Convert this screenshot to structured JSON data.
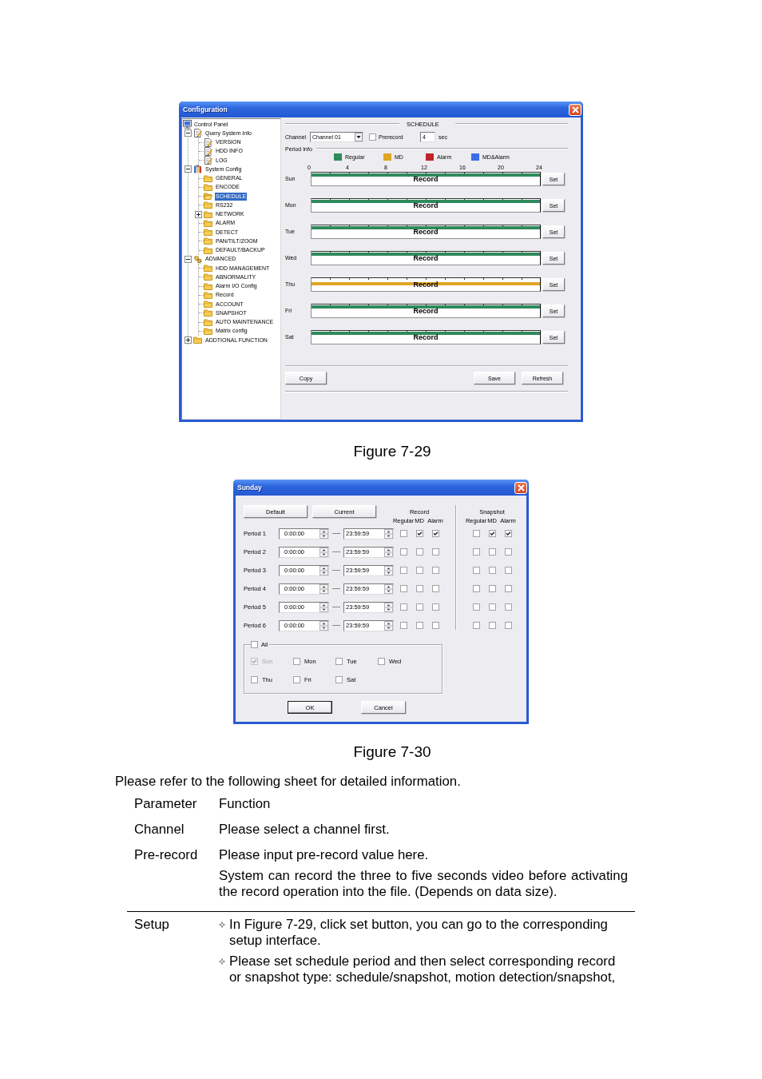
{
  "config_window": {
    "window": {
      "title": "Configuration"
    },
    "tree": [
      {
        "label": "Control Panel",
        "kind": "computer",
        "selected": false,
        "children": [
          {
            "label": "Query System Info",
            "kind": "document",
            "expanded": true,
            "selected": false,
            "children": [
              {
                "label": "VERSION",
                "kind": "document",
                "selected": false
              },
              {
                "label": "HDD INFO",
                "kind": "document",
                "selected": false
              },
              {
                "label": "LOG",
                "kind": "document",
                "selected": false
              }
            ]
          },
          {
            "label": "System Config",
            "kind": "tools",
            "expanded": true,
            "selected": false,
            "children": [
              {
                "label": "GENERAL",
                "kind": "folder",
                "selected": false
              },
              {
                "label": "ENCODE",
                "kind": "folder",
                "selected": false
              },
              {
                "label": "SCHEDULE",
                "kind": "folder",
                "selected": true
              },
              {
                "label": "RS232",
                "kind": "folder",
                "selected": false
              },
              {
                "label": "NETWORK",
                "kind": "folder",
                "expanded": false,
                "selected": false
              },
              {
                "label": "ALARM",
                "kind": "folder",
                "selected": false
              },
              {
                "label": "DETECT",
                "kind": "folder",
                "selected": false
              },
              {
                "label": "PAN/TILT/ZOOM",
                "kind": "folder",
                "selected": false
              },
              {
                "label": "DEFAULT/BACKUP",
                "kind": "folder",
                "selected": false
              }
            ]
          },
          {
            "label": "ADVANCED",
            "kind": "gears",
            "expanded": true,
            "selected": false,
            "children": [
              {
                "label": "HDD MANAGEMENT",
                "kind": "folder",
                "selected": false
              },
              {
                "label": "ABNORMALITY",
                "kind": "folder",
                "selected": false
              },
              {
                "label": "Alarm I/O Config",
                "kind": "folder",
                "selected": false
              },
              {
                "label": "Record",
                "kind": "folder",
                "selected": false
              },
              {
                "label": "ACCOUNT",
                "kind": "folder",
                "selected": false
              },
              {
                "label": "SNAPSHOT",
                "kind": "folder",
                "selected": false
              },
              {
                "label": "AUTO MAINTENANCE",
                "kind": "folder",
                "selected": false
              },
              {
                "label": "Matrix config",
                "kind": "folder",
                "selected": false
              }
            ]
          },
          {
            "label": "ADDTIONAL FUNCTION",
            "kind": "folder",
            "expanded": false,
            "selected": false
          }
        ]
      }
    ],
    "schedule": {
      "title": "SCHEDULE",
      "channel": {
        "label": "Channel",
        "value": "Channel 01"
      },
      "prerecord": {
        "label": "Prerecord",
        "checked": false,
        "value": "4",
        "unit": "sec"
      },
      "period_info": "Period Info",
      "legend": [
        {
          "label": "Regular",
          "color": "#2f8a5c"
        },
        {
          "label": "MD",
          "color": "#e0a524"
        },
        {
          "label": "Alarm",
          "color": "#c0232a"
        },
        {
          "label": "MD&Alarm",
          "color": "#3a6fe8"
        }
      ],
      "hours": [
        "0",
        "4",
        "8",
        "12",
        "16",
        "20",
        "24"
      ],
      "days": [
        {
          "label": "Sun",
          "color": "#2f8a5c",
          "bar_text": "Record",
          "button": "Set"
        },
        {
          "label": "Mon",
          "color": "#2f8a5c",
          "bar_text": "Record",
          "button": "Set"
        },
        {
          "label": "Tue",
          "color": "#2f8a5c",
          "bar_text": "Record",
          "button": "Set"
        },
        {
          "label": "Wed",
          "color": "#2f8a5c",
          "bar_text": "Record",
          "button": "Set"
        },
        {
          "label": "Thu",
          "color": "#e0a524",
          "bar_text": "Record",
          "button": "Set"
        },
        {
          "label": "Fri",
          "color": "#2f8a5c",
          "bar_text": "Record",
          "button": "Set"
        },
        {
          "label": "Sat",
          "color": "#2f8a5c",
          "bar_text": "Record",
          "button": "Set"
        }
      ],
      "buttons": [
        "Copy",
        "Save",
        "Refresh"
      ]
    },
    "caption": "Figure 7-29"
  },
  "period_dialog": {
    "window": {
      "title": "Sunday"
    },
    "presets": [
      "Default",
      "Current"
    ],
    "record": {
      "title": "Record",
      "columns": [
        "Regular",
        "MD",
        "Alarm"
      ]
    },
    "snapshot": {
      "title": "Snapshot",
      "columns": [
        "Regular",
        "MD",
        "Alarm"
      ]
    },
    "periods": [
      {
        "label": "Period 1",
        "start": "0:00:00",
        "end": "23:59:59",
        "record": [
          false,
          true,
          true
        ],
        "snapshot": [
          false,
          true,
          true
        ]
      },
      {
        "label": "Period 2",
        "start": "0:00:00",
        "end": "23:59:59",
        "record": [
          false,
          false,
          false
        ],
        "snapshot": [
          false,
          false,
          false
        ]
      },
      {
        "label": "Period 3",
        "start": "0:00:00",
        "end": "23:59:59",
        "record": [
          false,
          false,
          false
        ],
        "snapshot": [
          false,
          false,
          false
        ]
      },
      {
        "label": "Period 4",
        "start": "0:00:00",
        "end": "23:59:59",
        "record": [
          false,
          false,
          false
        ],
        "snapshot": [
          false,
          false,
          false
        ]
      },
      {
        "label": "Period 5",
        "start": "0:00:00",
        "end": "23:59:59",
        "record": [
          false,
          false,
          false
        ],
        "snapshot": [
          false,
          false,
          false
        ]
      },
      {
        "label": "Period 6",
        "start": "0:00:00",
        "end": "23:59:59",
        "record": [
          false,
          false,
          false
        ],
        "snapshot": [
          false,
          false,
          false
        ]
      }
    ],
    "all": {
      "label": "All",
      "checked": false
    },
    "days": [
      {
        "label": "Sun",
        "checked": true,
        "disabled": true
      },
      {
        "label": "Mon",
        "checked": false,
        "disabled": false
      },
      {
        "label": "Tue",
        "checked": false,
        "disabled": false
      },
      {
        "label": "Wed",
        "checked": false,
        "disabled": false
      },
      {
        "label": "Thu",
        "checked": false,
        "disabled": false
      },
      {
        "label": "Fri",
        "checked": false,
        "disabled": false
      },
      {
        "label": "Sat",
        "checked": false,
        "disabled": false
      }
    ],
    "buttons": [
      {
        "label": "OK",
        "default": true
      },
      {
        "label": "Cancel",
        "default": false
      }
    ],
    "caption": "Figure 7-30"
  },
  "intro": "Please refer to the following sheet for detailed information.",
  "table": {
    "columns": [
      "Parameter",
      "Function"
    ],
    "rows": [
      {
        "kind": "text",
        "rule_above": false,
        "parameter": "Channel",
        "function": [
          "Please select a channel first."
        ]
      },
      {
        "kind": "text",
        "rule_above": false,
        "parameter": "Pre-record",
        "function": [
          "Please input pre-record value here.",
          "System can record the three to five seconds video before activating the record operation into the file. (Depends on data size)."
        ]
      },
      {
        "kind": "bullets",
        "rule_above": true,
        "parameter": "Setup",
        "function": [
          "In Figure 7-29, click set button, you can go to the corresponding setup interface.",
          "Please set schedule period and then select corresponding record or snapshot type: schedule/snapshot, motion detection/snapshot,"
        ]
      }
    ]
  }
}
